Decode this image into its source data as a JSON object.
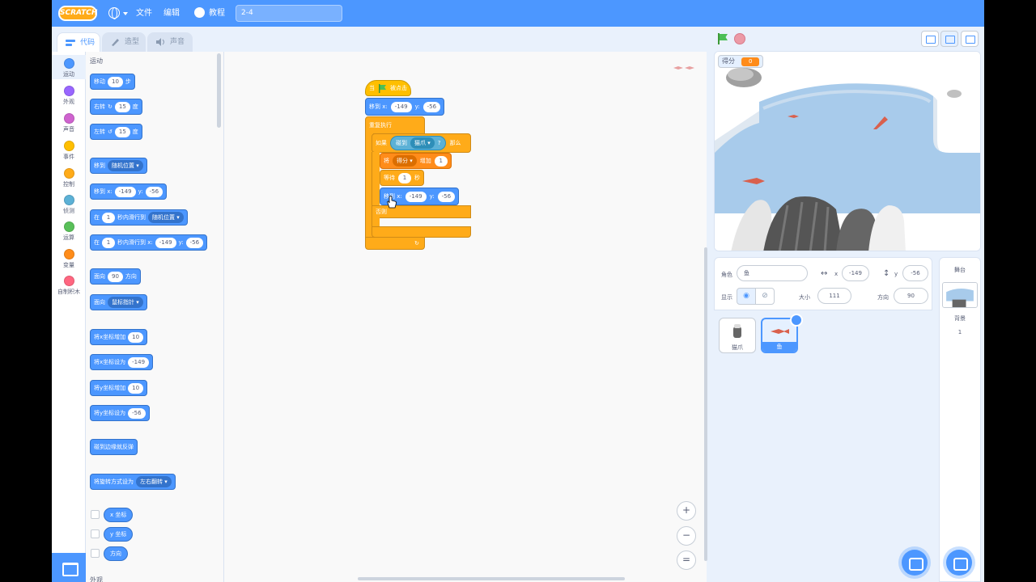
{
  "menu": {
    "logo": "SCRATCH",
    "file": "文件",
    "edit": "编辑",
    "tutorials": "教程",
    "project_title": "2-4"
  },
  "tabs": [
    {
      "label": "代码",
      "active": true
    },
    {
      "label": "造型",
      "active": false
    },
    {
      "label": "声音",
      "active": false
    }
  ],
  "categories": [
    {
      "label": "运动",
      "color": "#4c97ff"
    },
    {
      "label": "外观",
      "color": "#9966ff"
    },
    {
      "label": "声音",
      "color": "#cf63cf"
    },
    {
      "label": "事件",
      "color": "#ffbf00"
    },
    {
      "label": "控制",
      "color": "#ffab19"
    },
    {
      "label": "侦测",
      "color": "#5cb1d6"
    },
    {
      "label": "运算",
      "color": "#59c059"
    },
    {
      "label": "变量",
      "color": "#ff8c1a"
    },
    {
      "label": "自制积木",
      "color": "#ff6680"
    }
  ],
  "palette": {
    "title": "运动",
    "move": {
      "a": "移动",
      "n": "10",
      "b": "步"
    },
    "turn_right": {
      "a": "右转",
      "n": "15",
      "b": "度"
    },
    "turn_left": {
      "a": "左转",
      "n": "15",
      "b": "度"
    },
    "goto": {
      "a": "移到",
      "d": "随机位置"
    },
    "goto_xy": {
      "a": "移到 x:",
      "x": "-149",
      "b": "y:",
      "y": "-56"
    },
    "glide_to": {
      "a": "在",
      "n": "1",
      "b": "秒内滑行到",
      "d": "随机位置"
    },
    "glide_xy": {
      "a": "在",
      "n": "1",
      "b": "秒内滑行到 x:",
      "x": "-149",
      "c": "y:",
      "y": "-56"
    },
    "point_dir": {
      "a": "面向",
      "n": "90",
      "b": "方向"
    },
    "point_towards": {
      "a": "面向",
      "d": "鼠标指针"
    },
    "change_x": {
      "a": "将x坐标增加",
      "n": "10"
    },
    "set_x": {
      "a": "将x坐标设为",
      "n": "-149"
    },
    "change_y": {
      "a": "将y坐标增加",
      "n": "10"
    },
    "set_y": {
      "a": "将y坐标设为",
      "n": "-56"
    },
    "bounce": "碰到边缘就反弹",
    "rotation": {
      "a": "将旋转方式设为",
      "d": "左右翻转"
    },
    "rep_x": "x 坐标",
    "rep_y": "y 坐标",
    "rep_dir": "方向",
    "next_title": "外观"
  },
  "script": {
    "hat": {
      "a": "当",
      "b": "被点击"
    },
    "goto": {
      "a": "移到 x:",
      "x": "-149",
      "b": "y:",
      "y": "-56"
    },
    "forever": "重复执行",
    "if": {
      "a": "如果",
      "touch": "碰到",
      "d": "猫爪",
      "q": "?",
      "b": "那么"
    },
    "change_var": {
      "a": "将",
      "d": "得分",
      "b": "增加",
      "n": "1"
    },
    "wait": {
      "a": "等待",
      "n": "1",
      "b": "秒"
    },
    "goto2": {
      "a": "移到 x:",
      "x": "-149",
      "b": "y:",
      "y": "-56"
    },
    "else": "否则"
  },
  "zoom": {
    "in": "+",
    "out": "−",
    "reset": "="
  },
  "stage": {
    "monitor_label": "得分",
    "monitor_value": "0"
  },
  "sprite_info": {
    "sprite_label": "角色",
    "sprite_name": "鱼",
    "x_label": "x",
    "x_value": "-149",
    "y_label": "y",
    "y_value": "-56",
    "show_label": "显示",
    "size_label": "大小",
    "size_value": "111",
    "direction_label": "方向",
    "direction_value": "90"
  },
  "sprites": [
    {
      "name": "猫爪",
      "selected": false
    },
    {
      "name": "鱼",
      "selected": true
    }
  ],
  "stage_pane": {
    "title": "舞台",
    "backdrops_label": "背景",
    "backdrops_count": "1"
  }
}
